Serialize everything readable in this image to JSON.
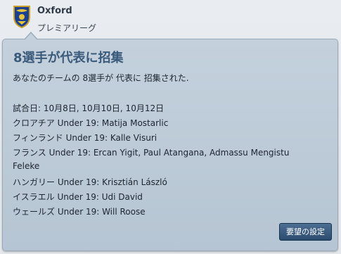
{
  "header": {
    "club_name": "Oxford",
    "league_name": "プレミアリーグ",
    "crest_icon": "club-crest-icon"
  },
  "panel": {
    "title": "8選手が代表に招集",
    "intro": "あなたのチームの 8選手が 代表に 招集された.",
    "match_dates": "試合日:  10月8日, 10月10日, 10月12日",
    "callups": [
      "クロアチア Under 19: Matija Mostarlic",
      "フィンランド Under 19: Kalle Visuri",
      "フランス Under 19: Ercan Yigit, Paul Atangana, Admassu Mengistu",
      "Feleke",
      "ハンガリー Under 19: Krisztián László",
      "イスラエル Under 19: Udi David",
      "ウェールズ Under 19: Will Roose"
    ],
    "button_label": "要望の設定"
  },
  "colors": {
    "panel_bg": "#c4d1dd",
    "title": "#3a5a7c",
    "button_bg": "#2c4c6f"
  }
}
